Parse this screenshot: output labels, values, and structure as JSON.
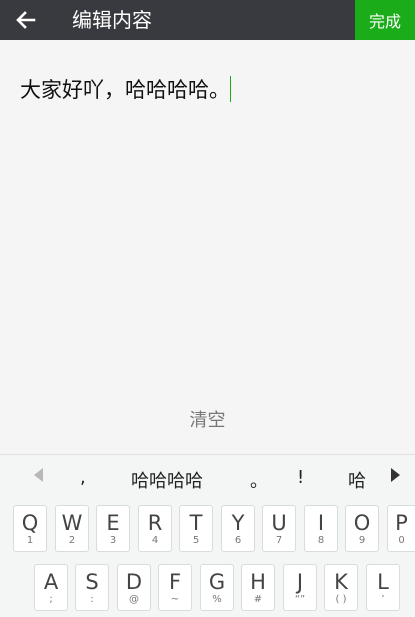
{
  "header": {
    "title": "编辑内容",
    "done_label": "完成"
  },
  "editor": {
    "text": "大家好吖，哈哈哈哈。"
  },
  "clear_label": "清空",
  "colors": {
    "header_bg": "#393a3f",
    "accent": "#1aad19"
  },
  "candidates": [
    ",",
    "哈哈哈哈",
    "。",
    "!",
    "哈"
  ],
  "keyboard": {
    "row1": [
      {
        "main": "Q",
        "sub": "1"
      },
      {
        "main": "W",
        "sub": "2"
      },
      {
        "main": "E",
        "sub": "3"
      },
      {
        "main": "R",
        "sub": "4"
      },
      {
        "main": "T",
        "sub": "5"
      },
      {
        "main": "Y",
        "sub": "6"
      },
      {
        "main": "U",
        "sub": "7"
      },
      {
        "main": "I",
        "sub": "8"
      },
      {
        "main": "O",
        "sub": "9"
      },
      {
        "main": "P",
        "sub": "0"
      }
    ],
    "row2": [
      {
        "main": "A",
        "sub": ";"
      },
      {
        "main": "S",
        "sub": ":"
      },
      {
        "main": "D",
        "sub": "@"
      },
      {
        "main": "F",
        "sub": "~"
      },
      {
        "main": "G",
        "sub": "%"
      },
      {
        "main": "H",
        "sub": "#"
      },
      {
        "main": "J",
        "sub": "“”"
      },
      {
        "main": "K",
        "sub": "( )"
      },
      {
        "main": "L",
        "sub": "’"
      }
    ]
  }
}
